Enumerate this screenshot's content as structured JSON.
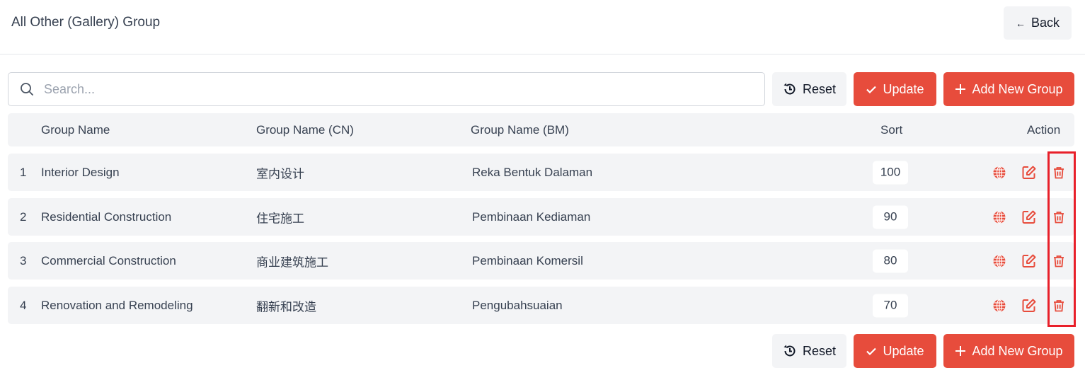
{
  "header": {
    "title": "All Other (Gallery) Group",
    "back_label": "Back"
  },
  "toolbar": {
    "search_placeholder": "Search...",
    "search_value": "",
    "reset_label": "Reset",
    "update_label": "Update",
    "add_label": "Add New Group"
  },
  "table": {
    "columns": [
      "Group Name",
      "Group Name (CN)",
      "Group Name (BM)",
      "Sort",
      "Action"
    ],
    "rows": [
      {
        "index": "1",
        "name": "Interior Design",
        "name_cn": "室内设计",
        "name_bm": "Reka Bentuk Dalaman",
        "sort": "100"
      },
      {
        "index": "2",
        "name": "Residential Construction",
        "name_cn": "住宅施工",
        "name_bm": "Pembinaan Kediaman",
        "sort": "90"
      },
      {
        "index": "3",
        "name": "Commercial Construction",
        "name_cn": "商业建筑施工",
        "name_bm": "Pembinaan Komersil",
        "sort": "80"
      },
      {
        "index": "4",
        "name": "Renovation and Remodeling",
        "name_cn": "翻新和改造",
        "name_bm": "Pengubahsuaian",
        "sort": "70"
      }
    ]
  },
  "colors": {
    "accent": "#e74c3c",
    "highlight": "#e8202a"
  }
}
